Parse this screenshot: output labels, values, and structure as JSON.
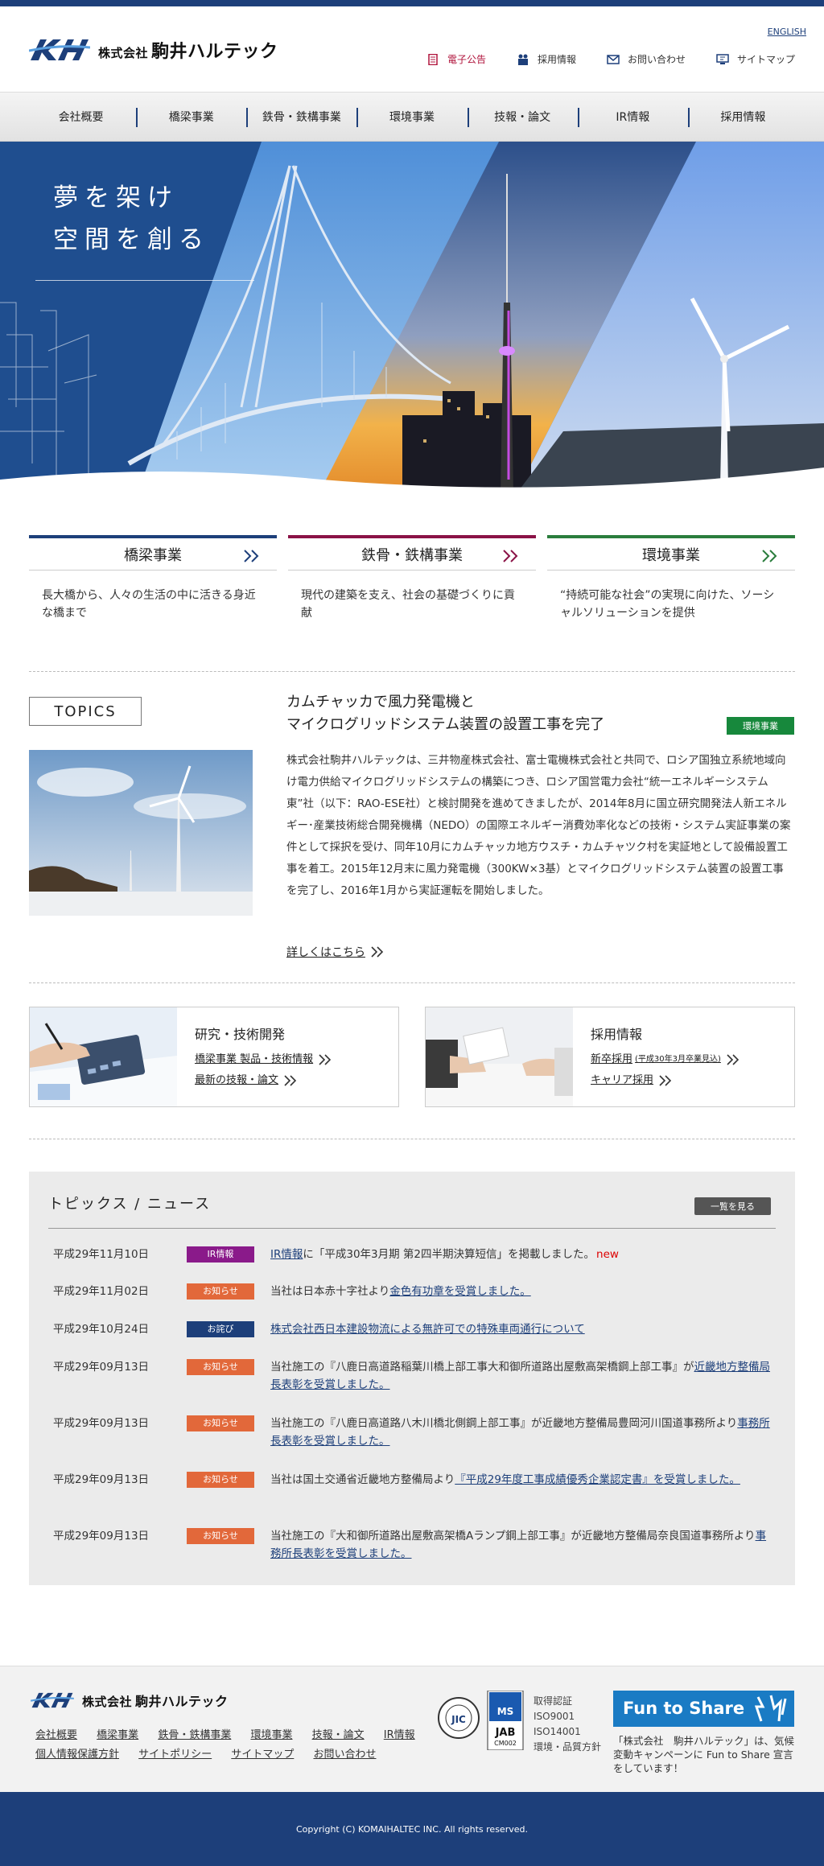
{
  "header": {
    "english": "ENGLISH",
    "logo_small": "株式会社",
    "logo_name": "駒井ハルテック",
    "util": [
      {
        "label": "電子公告",
        "icon": "document-icon"
      },
      {
        "label": "採用情報",
        "icon": "people-icon"
      },
      {
        "label": "お問い合わせ",
        "icon": "mail-icon"
      },
      {
        "label": "サイトマップ",
        "icon": "sitemap-icon"
      }
    ]
  },
  "nav": [
    "会社概要",
    "橋梁事業",
    "鉄骨・鉄構事業",
    "環境事業",
    "技報・論文",
    "IR情報",
    "採用情報"
  ],
  "hero": {
    "line1": "夢を架け",
    "line2": "空間を創る"
  },
  "business": [
    {
      "title": "橋梁事業",
      "desc": "長大橋から、人々の生活の中に活きる身近な橋まで",
      "color": "#1d3f7a"
    },
    {
      "title": "鉄骨・鉄構事業",
      "desc": "現代の建築を支え、社会の基礎づくりに貢献",
      "color": "#8a1246"
    },
    {
      "title": "環境事業",
      "desc": "“持続可能な社会”の実現に向けた、ソーシャルソリューションを提供",
      "color": "#2a7d3c"
    }
  ],
  "topics": {
    "label": "TOPICS",
    "title1": "カムチャッカで風力発電機と",
    "title2": "マイクログリッドシステム装置の設置工事を完了",
    "tag": "環境事業",
    "tag_color": "#17883c",
    "body": "株式会社駒井ハルテックは、三井物産株式会社、富士電機株式会社と共同で、ロシア国独立系統地域向け電力供給マイクログリッドシステムの構築につき、ロシア国営電力会社“統一エネルギーシステム東”社（以下：RAO-ESE社）と検討開発を進めてきましたが、2014年8月に国立研究開発法人新エネルギー･産業技術総合開発機構（NEDO）の国際エネルギー消費効率化などの技術・システム実証事業の案件として採択を受け、同年10月にカムチャッカ地方ウスチ・カムチャツク村を実証地として設備設置工事を着工。2015年12月末に風力発電機（300KW×3基）とマイクログリッドシステム装置の設置工事を完了し、2016年1月から実証運転を開始しました。",
    "more": "詳しくはこちら"
  },
  "promo": [
    {
      "title": "研究・技術開発",
      "links": [
        {
          "text": "橋梁事業 製品・技術情報",
          "note": ""
        },
        {
          "text": "最新の技報・論文",
          "note": ""
        }
      ]
    },
    {
      "title": "採用情報",
      "links": [
        {
          "text": "新卒採用",
          "note": "(平成30年3月卒業見込)"
        },
        {
          "text": "キャリア採用",
          "note": ""
        }
      ]
    }
  ],
  "news": {
    "title": "トピックス / ニュース",
    "all": "一覧を見る",
    "items": [
      {
        "date": "平成29年11月10日",
        "cat": "IR情報",
        "cat_color": "#8a1a8a",
        "pre": "",
        "link": "IR情報",
        "post": "に「平成30年3月期 第2四半期決算短信」を掲載しました。",
        "new": "new"
      },
      {
        "date": "平成29年11月02日",
        "cat": "お知らせ",
        "cat_color": "#e2683a",
        "pre": "当社は日本赤十字社より",
        "link": "金色有功章を受賞しました。",
        "post": "",
        "new": ""
      },
      {
        "date": "平成29年10月24日",
        "cat": "お詫び",
        "cat_color": "#1d3f7a",
        "pre": "",
        "link": "株式会社西日本建設物流による無許可での特殊車両通行について",
        "post": "",
        "new": ""
      },
      {
        "date": "平成29年09月13日",
        "cat": "お知らせ",
        "cat_color": "#e2683a",
        "pre": "当社施工の『八鹿日高道路稲葉川橋上部工事大和御所道路出屋敷高架橋鋼上部工事』が",
        "link": "近畿地方整備局長表彰を受賞しました。",
        "post": "",
        "new": ""
      },
      {
        "date": "平成29年09月13日",
        "cat": "お知らせ",
        "cat_color": "#e2683a",
        "pre": "当社施工の『八鹿日高道路八木川橋北側鋼上部工事』が近畿地方整備局豊岡河川国道事務所より",
        "link": "事務所長表彰を受賞しました。",
        "post": "",
        "new": ""
      },
      {
        "date": "平成29年09月13日",
        "cat": "お知らせ",
        "cat_color": "#e2683a",
        "pre": "当社は国土交通省近畿地方整備局より",
        "link": "『平成29年度工事成績優秀企業認定書』を受賞しました。",
        "post": "",
        "new": ""
      },
      {
        "date": "平成29年09月13日",
        "cat": "お知らせ",
        "cat_color": "#e2683a",
        "pre": "当社施工の『大和御所道路出屋敷高架橋Aランプ鋼上部工事』が近畿地方整備局奈良国道事務所より",
        "link": "事務所長表彰を受賞しました。",
        "post": "",
        "new": ""
      }
    ]
  },
  "footer": {
    "links": [
      "会社概要",
      "橋梁事業",
      "鉄骨・鉄構事業",
      "環境事業",
      "技報・論文",
      "IR情報",
      "個人情報保護方針",
      "サイトポリシー",
      "サイトマップ",
      "お問い合わせ"
    ],
    "cert": [
      "取得認証",
      "ISO9001",
      "ISO14001",
      "環境・品質方針"
    ],
    "cert_badges": [
      "JIC",
      "MS",
      "JAB",
      "CM002"
    ],
    "fts_logo": "Fun to Share",
    "fts_text": "「株式会社　駒井ハルテック」は、気候変動キャンペーンに Fun to Share 宣言をしています！",
    "copyright": "Copyright (C) KOMAIHALTEC INC. All rights reserved."
  }
}
